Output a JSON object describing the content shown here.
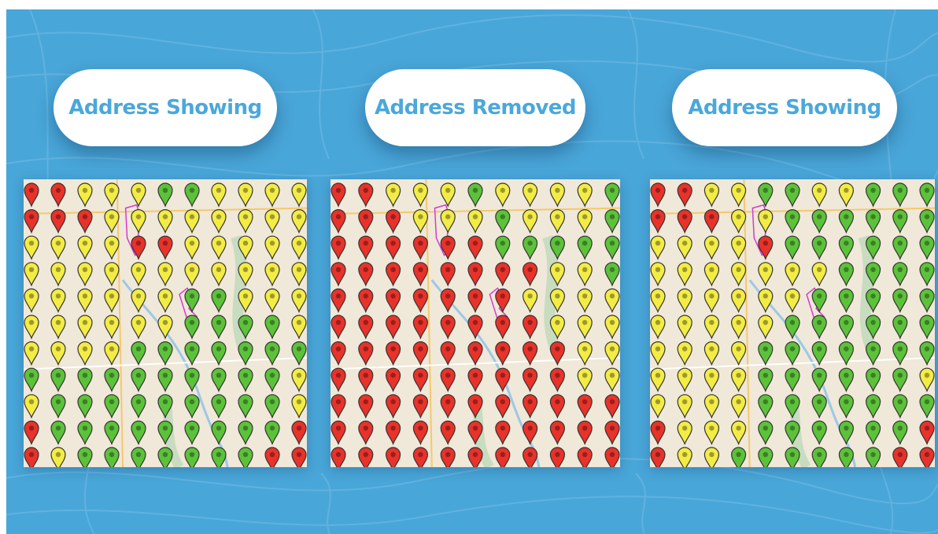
{
  "panels": [
    {
      "title": "Address Showing",
      "grid": [
        [
          "red",
          "red",
          "yellow",
          "yellow",
          "yellow",
          "green",
          "green",
          "yellow",
          "yellow",
          "yellow",
          "yellow"
        ],
        [
          "red",
          "red",
          "red",
          "yellow",
          "yellow",
          "yellow",
          "yellow",
          "yellow",
          "yellow",
          "yellow",
          "yellow"
        ],
        [
          "yellow",
          "yellow",
          "yellow",
          "yellow",
          "red",
          "red",
          "yellow",
          "yellow",
          "yellow",
          "yellow",
          "yellow"
        ],
        [
          "yellow",
          "yellow",
          "yellow",
          "yellow",
          "yellow",
          "yellow",
          "yellow",
          "yellow",
          "yellow",
          "yellow",
          "yellow"
        ],
        [
          "yellow",
          "yellow",
          "yellow",
          "yellow",
          "yellow",
          "yellow",
          "green",
          "green",
          "yellow",
          "yellow",
          "yellow"
        ],
        [
          "yellow",
          "yellow",
          "yellow",
          "yellow",
          "yellow",
          "yellow",
          "green",
          "green",
          "green",
          "green",
          "yellow"
        ],
        [
          "yellow",
          "yellow",
          "yellow",
          "yellow",
          "green",
          "green",
          "green",
          "green",
          "green",
          "green",
          "green"
        ],
        [
          "green",
          "green",
          "green",
          "green",
          "green",
          "green",
          "green",
          "green",
          "green",
          "green",
          "yellow"
        ],
        [
          "yellow",
          "green",
          "green",
          "green",
          "green",
          "green",
          "green",
          "green",
          "green",
          "green",
          "yellow"
        ],
        [
          "red",
          "green",
          "green",
          "green",
          "green",
          "green",
          "green",
          "green",
          "green",
          "green",
          "red"
        ],
        [
          "red",
          "yellow",
          "green",
          "green",
          "green",
          "green",
          "green",
          "green",
          "green",
          "red",
          "red"
        ]
      ]
    },
    {
      "title": "Address Removed",
      "grid": [
        [
          "red",
          "red",
          "yellow",
          "yellow",
          "yellow",
          "green",
          "yellow",
          "yellow",
          "yellow",
          "yellow",
          "green"
        ],
        [
          "red",
          "red",
          "red",
          "yellow",
          "yellow",
          "yellow",
          "green",
          "yellow",
          "yellow",
          "yellow",
          "green"
        ],
        [
          "red",
          "red",
          "red",
          "red",
          "red",
          "red",
          "green",
          "green",
          "green",
          "green",
          "green"
        ],
        [
          "red",
          "red",
          "red",
          "red",
          "red",
          "red",
          "red",
          "red",
          "yellow",
          "yellow",
          "green"
        ],
        [
          "red",
          "red",
          "red",
          "red",
          "red",
          "red",
          "red",
          "yellow",
          "yellow",
          "yellow",
          "yellow"
        ],
        [
          "red",
          "red",
          "red",
          "red",
          "red",
          "red",
          "red",
          "red",
          "yellow",
          "yellow",
          "yellow"
        ],
        [
          "red",
          "red",
          "red",
          "red",
          "red",
          "red",
          "red",
          "red",
          "red",
          "yellow",
          "yellow"
        ],
        [
          "red",
          "red",
          "red",
          "red",
          "red",
          "red",
          "red",
          "red",
          "red",
          "yellow",
          "yellow"
        ],
        [
          "red",
          "red",
          "red",
          "red",
          "red",
          "red",
          "red",
          "red",
          "red",
          "red",
          "red"
        ],
        [
          "red",
          "red",
          "red",
          "red",
          "red",
          "red",
          "red",
          "red",
          "red",
          "red",
          "red"
        ],
        [
          "red",
          "red",
          "red",
          "red",
          "red",
          "red",
          "red",
          "red",
          "red",
          "red",
          "red"
        ]
      ]
    },
    {
      "title": "Address Showing",
      "grid": [
        [
          "red",
          "red",
          "yellow",
          "yellow",
          "green",
          "green",
          "yellow",
          "yellow",
          "green",
          "green",
          "green"
        ],
        [
          "red",
          "red",
          "red",
          "yellow",
          "yellow",
          "green",
          "green",
          "green",
          "green",
          "green",
          "green"
        ],
        [
          "yellow",
          "yellow",
          "yellow",
          "yellow",
          "red",
          "green",
          "green",
          "green",
          "green",
          "green",
          "green"
        ],
        [
          "yellow",
          "yellow",
          "yellow",
          "yellow",
          "yellow",
          "yellow",
          "yellow",
          "green",
          "green",
          "green",
          "green"
        ],
        [
          "yellow",
          "yellow",
          "yellow",
          "yellow",
          "yellow",
          "yellow",
          "green",
          "green",
          "green",
          "green",
          "green"
        ],
        [
          "yellow",
          "yellow",
          "yellow",
          "yellow",
          "yellow",
          "green",
          "green",
          "green",
          "green",
          "green",
          "green"
        ],
        [
          "yellow",
          "yellow",
          "yellow",
          "yellow",
          "green",
          "green",
          "green",
          "green",
          "green",
          "green",
          "green"
        ],
        [
          "yellow",
          "yellow",
          "yellow",
          "yellow",
          "green",
          "green",
          "green",
          "green",
          "green",
          "green",
          "yellow"
        ],
        [
          "yellow",
          "yellow",
          "yellow",
          "yellow",
          "green",
          "green",
          "green",
          "green",
          "green",
          "green",
          "green"
        ],
        [
          "red",
          "yellow",
          "yellow",
          "yellow",
          "green",
          "green",
          "green",
          "green",
          "green",
          "green",
          "red"
        ],
        [
          "red",
          "yellow",
          "yellow",
          "green",
          "green",
          "green",
          "green",
          "green",
          "green",
          "red",
          "red"
        ]
      ]
    }
  ],
  "colors": {
    "background": "#49a6d8",
    "title_text": "#4aa8dc",
    "map_land": "#f0e8d8",
    "pin_red": "#e8322a",
    "pin_yellow": "#f3ec45",
    "pin_green": "#5cc23a"
  },
  "icons": [
    "map-pin-icon"
  ]
}
